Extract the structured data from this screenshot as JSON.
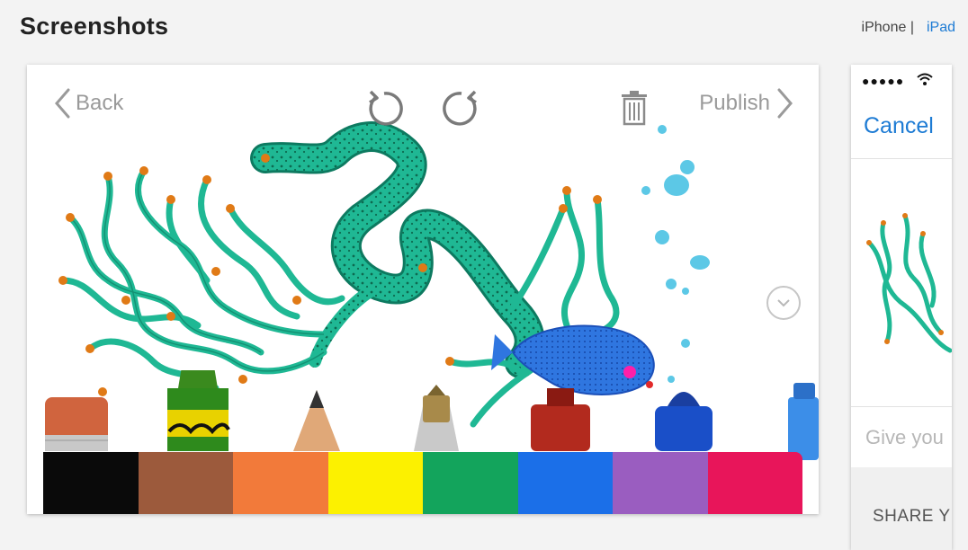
{
  "page": {
    "title": "Screenshots"
  },
  "device_toggle": {
    "iphone": "iPhone |",
    "ipad": "iPad"
  },
  "main_screenshot": {
    "nav": {
      "back_label": "Back",
      "publish_label": "Publish"
    },
    "palette": [
      "#0a0a0a",
      "#9c5a3c",
      "#f27a3a",
      "#fcf100",
      "#13a45c",
      "#1b6fe8",
      "#9a5dc0",
      "#e8155a"
    ],
    "colors": {
      "seaweed": "#1fb894",
      "seaweed_dark": "#0d7a60",
      "fish": "#2f76e0",
      "bubble": "#5cc8e6",
      "dot": "#e07a16"
    }
  },
  "side_screenshot": {
    "status_dots": "●●●●●",
    "cancel_label": "Cancel",
    "caption_placeholder": "Give you",
    "share_label": "SHARE Y"
  }
}
